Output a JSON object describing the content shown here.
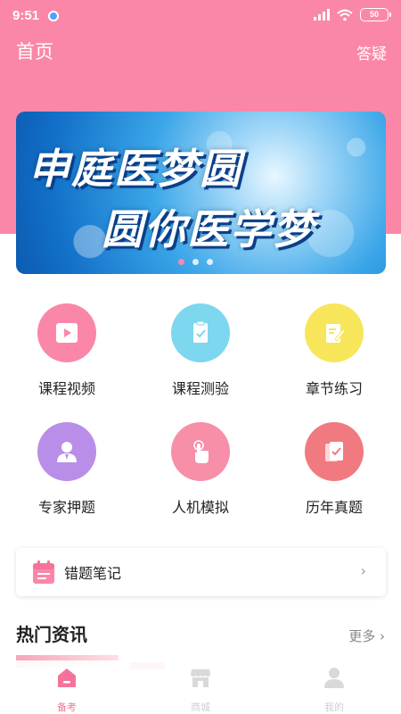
{
  "status_bar": {
    "time": "9:51",
    "battery": "50"
  },
  "nav": {
    "title": "首页",
    "action": "答疑"
  },
  "banner": {
    "line1": "申庭医梦圆",
    "line2": "圆你医学梦"
  },
  "grid": {
    "items": [
      {
        "label": "课程视频",
        "color": "#fb87a8",
        "icon": "play-icon"
      },
      {
        "label": "课程测验",
        "color": "#7dd7ee",
        "icon": "quiz-check-icon"
      },
      {
        "label": "章节练习",
        "color": "#f7e65a",
        "icon": "edit-note-icon"
      },
      {
        "label": "专家押题",
        "color": "#b98ee8",
        "icon": "expert-person-icon"
      },
      {
        "label": "人机模拟",
        "color": "#f78fa9",
        "icon": "touch-hand-icon"
      },
      {
        "label": "历年真题",
        "color": "#f07a80",
        "icon": "exam-paper-icon"
      }
    ]
  },
  "notes": {
    "label": "错题笔记",
    "icon": "calendar-icon"
  },
  "news": {
    "title": "热门资讯",
    "more": "更多"
  },
  "tabbar": {
    "tabs": [
      {
        "label": "备考",
        "icon": "home-icon",
        "active": true
      },
      {
        "label": "商城",
        "icon": "shop-icon",
        "active": false
      },
      {
        "label": "我的",
        "icon": "user-icon",
        "active": false
      }
    ]
  },
  "colors": {
    "brand_pink": "#fb87a8",
    "tab_active": "#f5739a"
  }
}
